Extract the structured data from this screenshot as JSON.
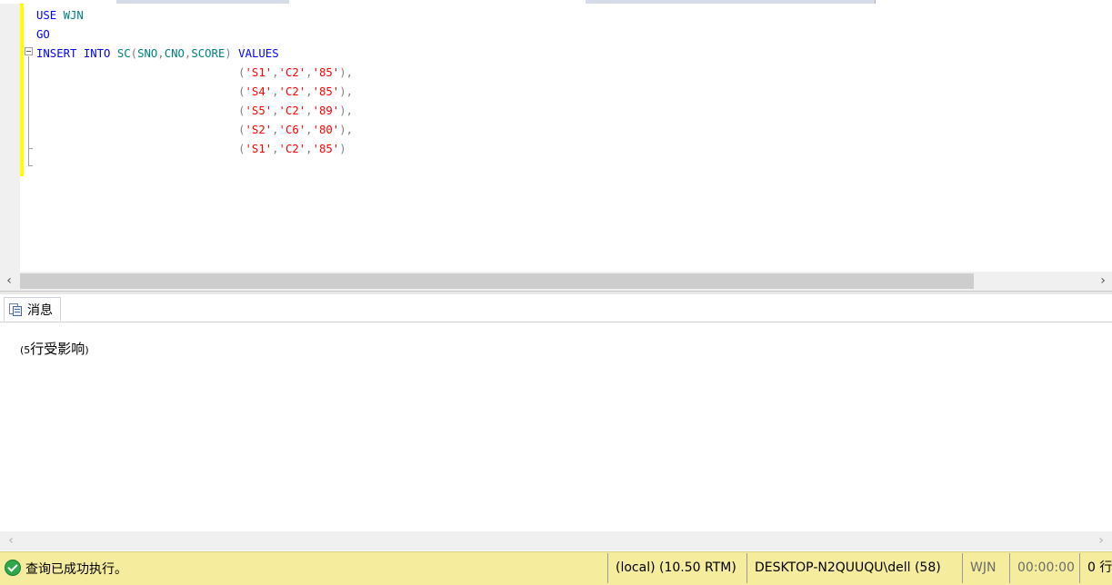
{
  "editor": {
    "lines": [
      [
        {
          "t": "USE",
          "c": "kw"
        },
        {
          "t": " ",
          "c": "pn"
        },
        {
          "t": "WJN",
          "c": "id"
        }
      ],
      [
        {
          "t": "GO",
          "c": "kw"
        }
      ],
      [
        {
          "t": "INSERT",
          "c": "kw"
        },
        {
          "t": " ",
          "c": "pn"
        },
        {
          "t": "INTO",
          "c": "kw"
        },
        {
          "t": " SC",
          "c": "id"
        },
        {
          "t": "(",
          "c": "pn"
        },
        {
          "t": "SNO",
          "c": "id"
        },
        {
          "t": ",",
          "c": "pn"
        },
        {
          "t": "CNO",
          "c": "id"
        },
        {
          "t": ",",
          "c": "pn"
        },
        {
          "t": "SCORE",
          "c": "id"
        },
        {
          "t": ") ",
          "c": "pn"
        },
        {
          "t": "VALUES",
          "c": "kw"
        }
      ],
      [
        {
          "t": "                              (",
          "c": "pn"
        },
        {
          "t": "'S1'",
          "c": "st"
        },
        {
          "t": ",",
          "c": "pn"
        },
        {
          "t": "'C2'",
          "c": "st"
        },
        {
          "t": ",",
          "c": "pn"
        },
        {
          "t": "'85'",
          "c": "st"
        },
        {
          "t": "),",
          "c": "pn"
        }
      ],
      [
        {
          "t": "                              (",
          "c": "pn"
        },
        {
          "t": "'S4'",
          "c": "st"
        },
        {
          "t": ",",
          "c": "pn"
        },
        {
          "t": "'C2'",
          "c": "st"
        },
        {
          "t": ",",
          "c": "pn"
        },
        {
          "t": "'85'",
          "c": "st"
        },
        {
          "t": "),",
          "c": "pn"
        }
      ],
      [
        {
          "t": "                              (",
          "c": "pn"
        },
        {
          "t": "'S5'",
          "c": "st"
        },
        {
          "t": ",",
          "c": "pn"
        },
        {
          "t": "'C2'",
          "c": "st"
        },
        {
          "t": ",",
          "c": "pn"
        },
        {
          "t": "'89'",
          "c": "st"
        },
        {
          "t": "),",
          "c": "pn"
        }
      ],
      [
        {
          "t": "                              (",
          "c": "pn"
        },
        {
          "t": "'S2'",
          "c": "st"
        },
        {
          "t": ",",
          "c": "pn"
        },
        {
          "t": "'C6'",
          "c": "st"
        },
        {
          "t": ",",
          "c": "pn"
        },
        {
          "t": "'80'",
          "c": "st"
        },
        {
          "t": "),",
          "c": "pn"
        }
      ],
      [
        {
          "t": "                              (",
          "c": "pn"
        },
        {
          "t": "'S1'",
          "c": "st"
        },
        {
          "t": ",",
          "c": "pn"
        },
        {
          "t": "'C2'",
          "c": "st"
        },
        {
          "t": ",",
          "c": "pn"
        },
        {
          "t": "'85'",
          "c": "st"
        },
        {
          "t": ")",
          "c": "pn"
        }
      ]
    ]
  },
  "scroll": {
    "left_arrow": "‹",
    "right_arrow": "›"
  },
  "results": {
    "tab_label": "消息",
    "message_open": "(",
    "message_count": "5",
    "message_body": " 行受影响",
    "message_close": ")"
  },
  "status": {
    "message": "查询已成功执行。",
    "server": "(local) (10.50 RTM)",
    "connection": "DESKTOP-N2QUUQU\\dell (58)",
    "database": "WJN",
    "elapsed": "00:00:00",
    "rows": "0 行"
  },
  "colors": {
    "keyword": "#0000ff",
    "identifier": "#008080",
    "punctuation": "#808080",
    "string": "#ff0000",
    "change_bar": "#ffff00",
    "status_bar": "#f5ec9e",
    "success_icon": "#2fa84b"
  },
  "icons": {
    "messages_tab": "messages-doc-icon",
    "status": "success-check-icon"
  }
}
